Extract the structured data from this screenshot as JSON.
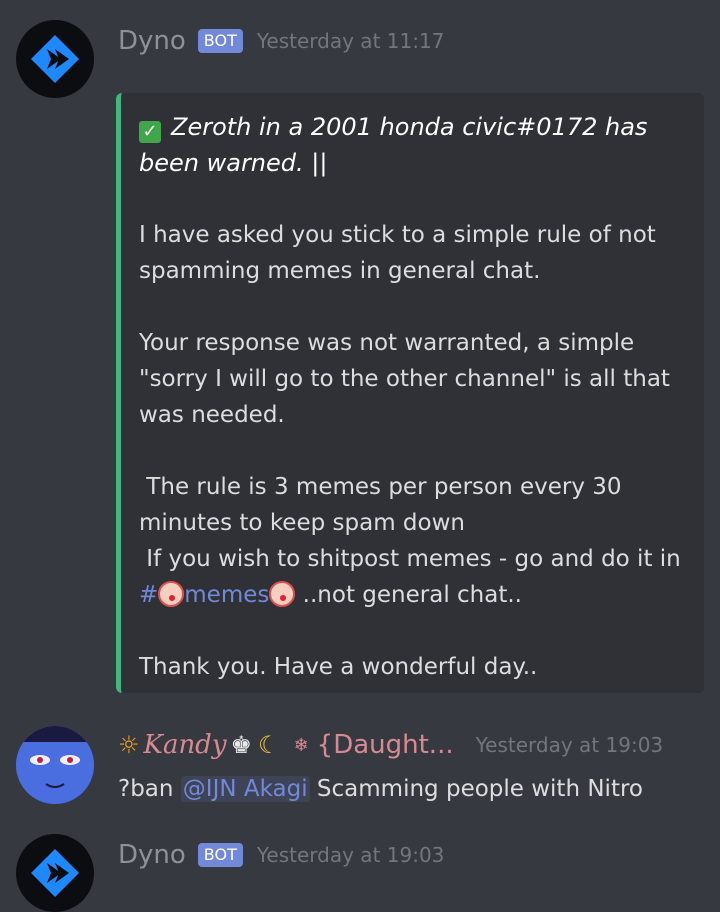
{
  "messages": [
    {
      "username": "Dyno",
      "bot_tag": "BOT",
      "timestamp": "Yesterday at 11:17",
      "embed": {
        "title": "Zeroth in a 2001 honda civic#0172 has been warned. ||",
        "title_line1": "Zeroth in a 2001 honda civic#0172 has",
        "title_line2": "been warned. ||",
        "body_p1_line1": "I have asked you stick to a simple rule of not",
        "body_p1_line2": "spamming memes in general chat.",
        "body_p2_line1": "Your response was not warranted, a simple",
        "body_p2_line2": "\"sorry I will go to the other channel\" is all that",
        "body_p2_line3": "was needed.",
        "body_p3_line1": " The rule is 3 memes per person every 30",
        "body_p3_line2": "minutes to keep spam down",
        "body_p3_line3": " If you wish to shitpost memes - go and do it in",
        "channel_hash": "#",
        "channel_name": "memes",
        "after_channel": " ..not general chat..",
        "body_p4": "Thank you. Have a wonderful day.."
      }
    },
    {
      "username": "Kandy",
      "role_text": "{Daught...",
      "timestamp": "Yesterday at 19:03",
      "content_prefix": "?ban ",
      "mention": "@IJN Akagi",
      "content_suffix": " Scamming people with Nitro"
    },
    {
      "username": "Dyno",
      "bot_tag": "BOT",
      "timestamp": "Yesterday at 19:03"
    }
  ],
  "icons": {
    "dyno_avatar": "dyno-logo-icon",
    "check": "white-check-mark-icon",
    "clown": "clown-face-icon"
  },
  "colors": {
    "background": "#36393f",
    "embed_background": "#2f3136",
    "embed_border": "#43b581",
    "bot_tag": "#7289da",
    "mention": "#7289da",
    "kandy_name": "#d88a92"
  }
}
